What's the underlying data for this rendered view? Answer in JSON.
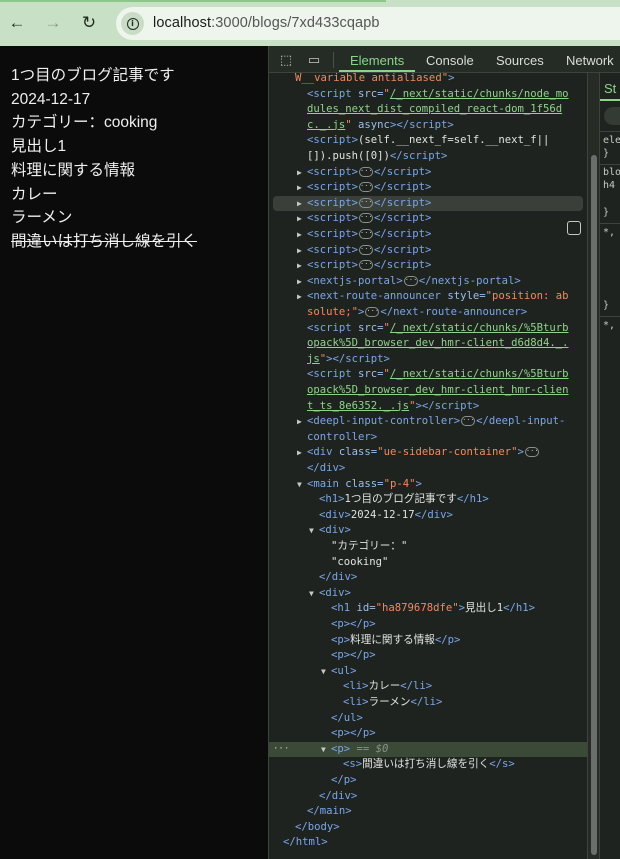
{
  "browser": {
    "back_icon": "←",
    "forward_icon": "→",
    "reload_icon": "↻",
    "info_icon": "i",
    "url_host": "localhost",
    "url_rest": ":3000/blogs/7xd433cqapb"
  },
  "page": {
    "title": "1つ目のブログ記事です",
    "date": "2024-12-17",
    "category": "カテゴリー：cooking",
    "heading": "見出し1",
    "paragraph": "料理に関する情報",
    "list": [
      "カレー",
      "ラーメン"
    ],
    "strikethrough": "間違いは打ち消し線を引く"
  },
  "devtools": {
    "tabs": [
      "Elements",
      "Console",
      "Sources",
      "Network"
    ],
    "active_tab": "Elements",
    "side_tab": "St",
    "selected_marker": "== $0",
    "styles_snippets": [
      "ele",
      "}",
      "blo",
      "h4",
      "}",
      "*,",
      "}",
      "*,"
    ],
    "dom": {
      "body_class_tail": "W__variable antialiased",
      "script1_src": "/_next/static/chunks/node_modules_next_dist_compiled_react-dom_1f56dc._.js",
      "script1_attr": "async",
      "script2_text": "(self.__next_f=self.__next_f||[]).push([0])",
      "collapsed_script_count": 7,
      "nextjs_portal": "nextjs-portal",
      "route_announcer": "next-route-announcer",
      "route_announcer_style": "position: absolute;",
      "hmr1_src": "/_next/static/chunks/%5Bturbopack%5D_browser_dev_hmr-client_d6d8d4._.js",
      "hmr2_src": "/_next/static/chunks/%5Bturbopack%5D_browser_dev_hmr-client_hmr-client_ts_8e6352._.js",
      "deepl": "deepl-input-controller",
      "sidebar_class": "ue-sidebar-container",
      "main_class": "p-4",
      "h1_text": "1つ目のブログ記事です",
      "date_text": "2024-12-17",
      "cat_text1": "\"カテゴリー：\"",
      "cat_text2": "\"cooking\"",
      "h1_id": "ha879678dfe",
      "h1_inner": "見出し1",
      "p_text": "料理に関する情報",
      "li1": "カレー",
      "li2": "ラーメン",
      "s_text": "間違いは打ち消し線を引く"
    }
  }
}
